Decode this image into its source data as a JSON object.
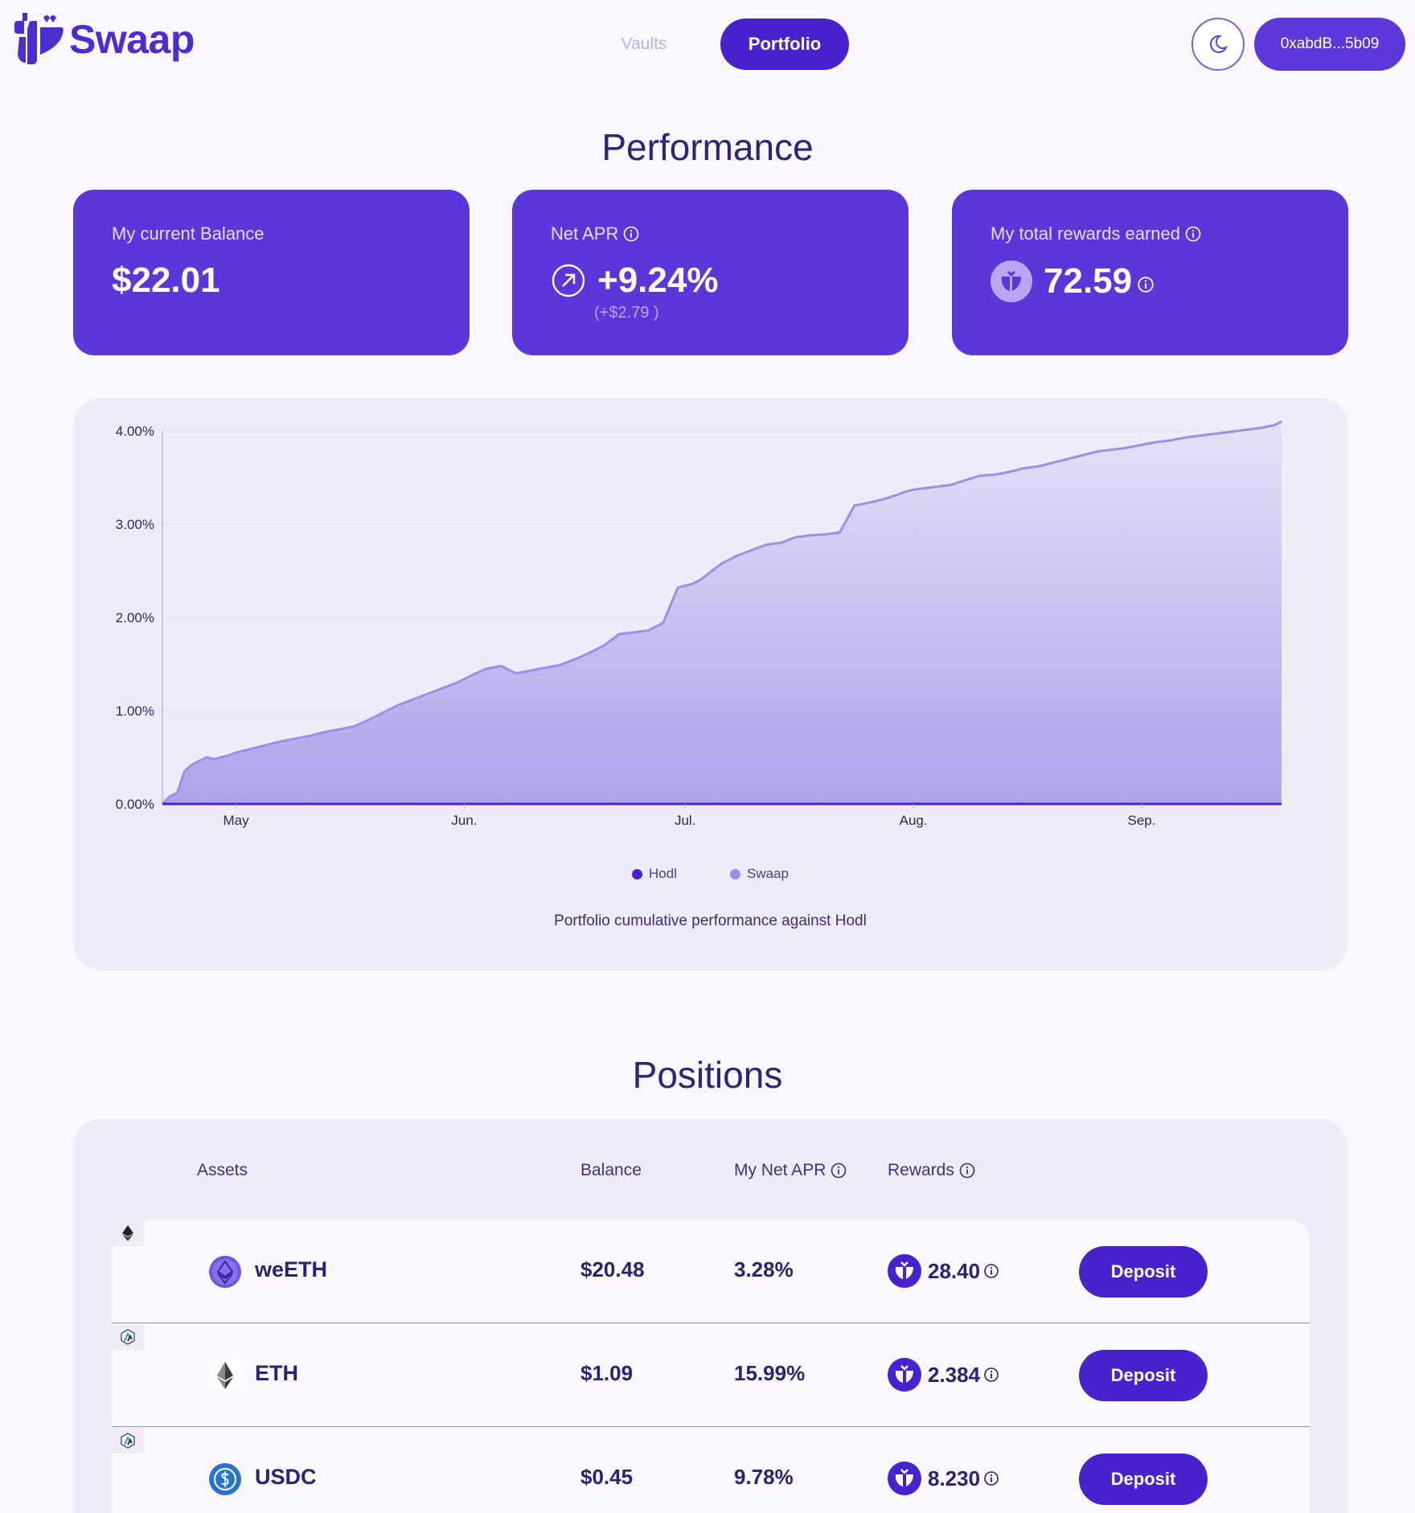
{
  "header": {
    "logo_text": "Swaap",
    "nav": {
      "vaults": "Vaults",
      "portfolio": "Portfolio"
    },
    "wallet_address": "0xabdB...5b09",
    "theme_icon": "moon-icon"
  },
  "performance": {
    "title": "Performance",
    "cards": [
      {
        "label": "My current Balance",
        "value": "$22.01"
      },
      {
        "label": "Net APR",
        "value": "+9.24%",
        "sub": "(+$2.79 )",
        "icon": "arrow-up-right-icon"
      },
      {
        "label": "My total rewards earned",
        "value": "72.59",
        "icon": "swaap-token-icon"
      }
    ]
  },
  "chart_data": {
    "type": "area",
    "caption": "Portfolio cumulative performance against Hodl",
    "y_ticks": [
      "4.00%",
      "3.00%",
      "2.00%",
      "1.00%",
      "0.00%"
    ],
    "ylim": [
      0,
      4
    ],
    "x_ticks": [
      "May",
      "Jun.",
      "Jul.",
      "Aug.",
      "Sep."
    ],
    "x_tick_dates": [
      "2024-05-01",
      "2024-06-01",
      "2024-07-01",
      "2024-08-01",
      "2024-09-01"
    ],
    "grid": true,
    "legend_position": "bottom",
    "series": [
      {
        "name": "Hodl",
        "color": "#4623cc",
        "x": [
          "2024-04-21",
          "2024-09-20"
        ],
        "values": [
          0,
          0
        ]
      },
      {
        "name": "Swaap",
        "color": "#9d8fe6",
        "x": [
          "2024-04-21",
          "2024-04-22",
          "2024-04-23",
          "2024-04-24",
          "2024-04-25",
          "2024-04-26",
          "2024-04-27",
          "2024-04-28",
          "2024-04-29",
          "2024-04-30",
          "2024-05-01",
          "2024-05-03",
          "2024-05-05",
          "2024-05-07",
          "2024-05-09",
          "2024-05-11",
          "2024-05-13",
          "2024-05-15",
          "2024-05-17",
          "2024-05-19",
          "2024-05-21",
          "2024-05-23",
          "2024-05-25",
          "2024-05-27",
          "2024-05-29",
          "2024-05-31",
          "2024-06-02",
          "2024-06-04",
          "2024-06-06",
          "2024-06-08",
          "2024-06-10",
          "2024-06-12",
          "2024-06-14",
          "2024-06-15",
          "2024-06-16",
          "2024-06-18",
          "2024-06-20",
          "2024-06-22",
          "2024-06-24",
          "2024-06-26",
          "2024-06-28",
          "2024-06-30",
          "2024-07-02",
          "2024-07-03",
          "2024-07-04",
          "2024-07-06",
          "2024-07-08",
          "2024-07-10",
          "2024-07-12",
          "2024-07-14",
          "2024-07-16",
          "2024-07-18",
          "2024-07-20",
          "2024-07-22",
          "2024-07-24",
          "2024-07-26",
          "2024-07-28",
          "2024-07-30",
          "2024-07-31",
          "2024-08-01",
          "2024-08-02",
          "2024-08-04",
          "2024-08-06",
          "2024-08-08",
          "2024-08-10",
          "2024-08-12",
          "2024-08-14",
          "2024-08-16",
          "2024-08-18",
          "2024-08-20",
          "2024-08-22",
          "2024-08-24",
          "2024-08-26",
          "2024-08-28",
          "2024-08-30",
          "2024-09-01",
          "2024-09-03",
          "2024-09-05",
          "2024-09-07",
          "2024-09-09",
          "2024-09-11",
          "2024-09-13",
          "2024-09-15",
          "2024-09-17",
          "2024-09-19",
          "2024-09-20"
        ],
        "values": [
          0.0,
          0.08,
          0.12,
          0.35,
          0.42,
          0.46,
          0.5,
          0.48,
          0.5,
          0.52,
          0.55,
          0.59,
          0.63,
          0.67,
          0.7,
          0.73,
          0.77,
          0.8,
          0.83,
          0.9,
          0.98,
          1.06,
          1.12,
          1.18,
          1.24,
          1.3,
          1.38,
          1.45,
          1.48,
          1.4,
          1.43,
          1.46,
          1.49,
          1.52,
          1.55,
          1.62,
          1.7,
          1.82,
          1.84,
          1.86,
          1.94,
          2.32,
          2.36,
          2.4,
          2.46,
          2.58,
          2.66,
          2.72,
          2.78,
          2.8,
          2.86,
          2.88,
          2.89,
          2.91,
          3.2,
          3.23,
          3.27,
          3.32,
          3.35,
          3.37,
          3.38,
          3.4,
          3.42,
          3.47,
          3.52,
          3.53,
          3.56,
          3.6,
          3.62,
          3.66,
          3.7,
          3.74,
          3.78,
          3.8,
          3.82,
          3.85,
          3.88,
          3.9,
          3.93,
          3.95,
          3.97,
          3.99,
          4.01,
          4.03,
          4.06,
          4.1
        ]
      }
    ]
  },
  "positions": {
    "title": "Positions",
    "columns": {
      "assets": "Assets",
      "balance": "Balance",
      "net_apr": "My Net APR",
      "rewards": "Rewards"
    },
    "rows": [
      {
        "chain_icon": "ethereum-chain-icon",
        "asset_icon": "weeth-icon",
        "asset": "weETH",
        "balance": "$20.48",
        "apr": "3.28%",
        "reward_icon": "swaap-token-icon",
        "rewards": "28.40",
        "action": "Deposit"
      },
      {
        "chain_icon": "arbitrum-chain-icon",
        "asset_icon": "eth-icon",
        "asset": "ETH",
        "balance": "$1.09",
        "apr": "15.99%",
        "reward_icon": "swaap-token-icon",
        "rewards": "2.384",
        "action": "Deposit"
      },
      {
        "chain_icon": "arbitrum-chain-icon",
        "asset_icon": "usdc-icon",
        "asset": "USDC",
        "balance": "$0.45",
        "apr": "9.78%",
        "reward_icon": "swaap-token-icon",
        "rewards": "8.230",
        "action": "Deposit"
      }
    ]
  },
  "colors": {
    "primary": "#4623cc",
    "card": "#5b37da",
    "panel": "#f0ebf8",
    "background": "#faf8fe",
    "area": "#9d8fe6"
  }
}
